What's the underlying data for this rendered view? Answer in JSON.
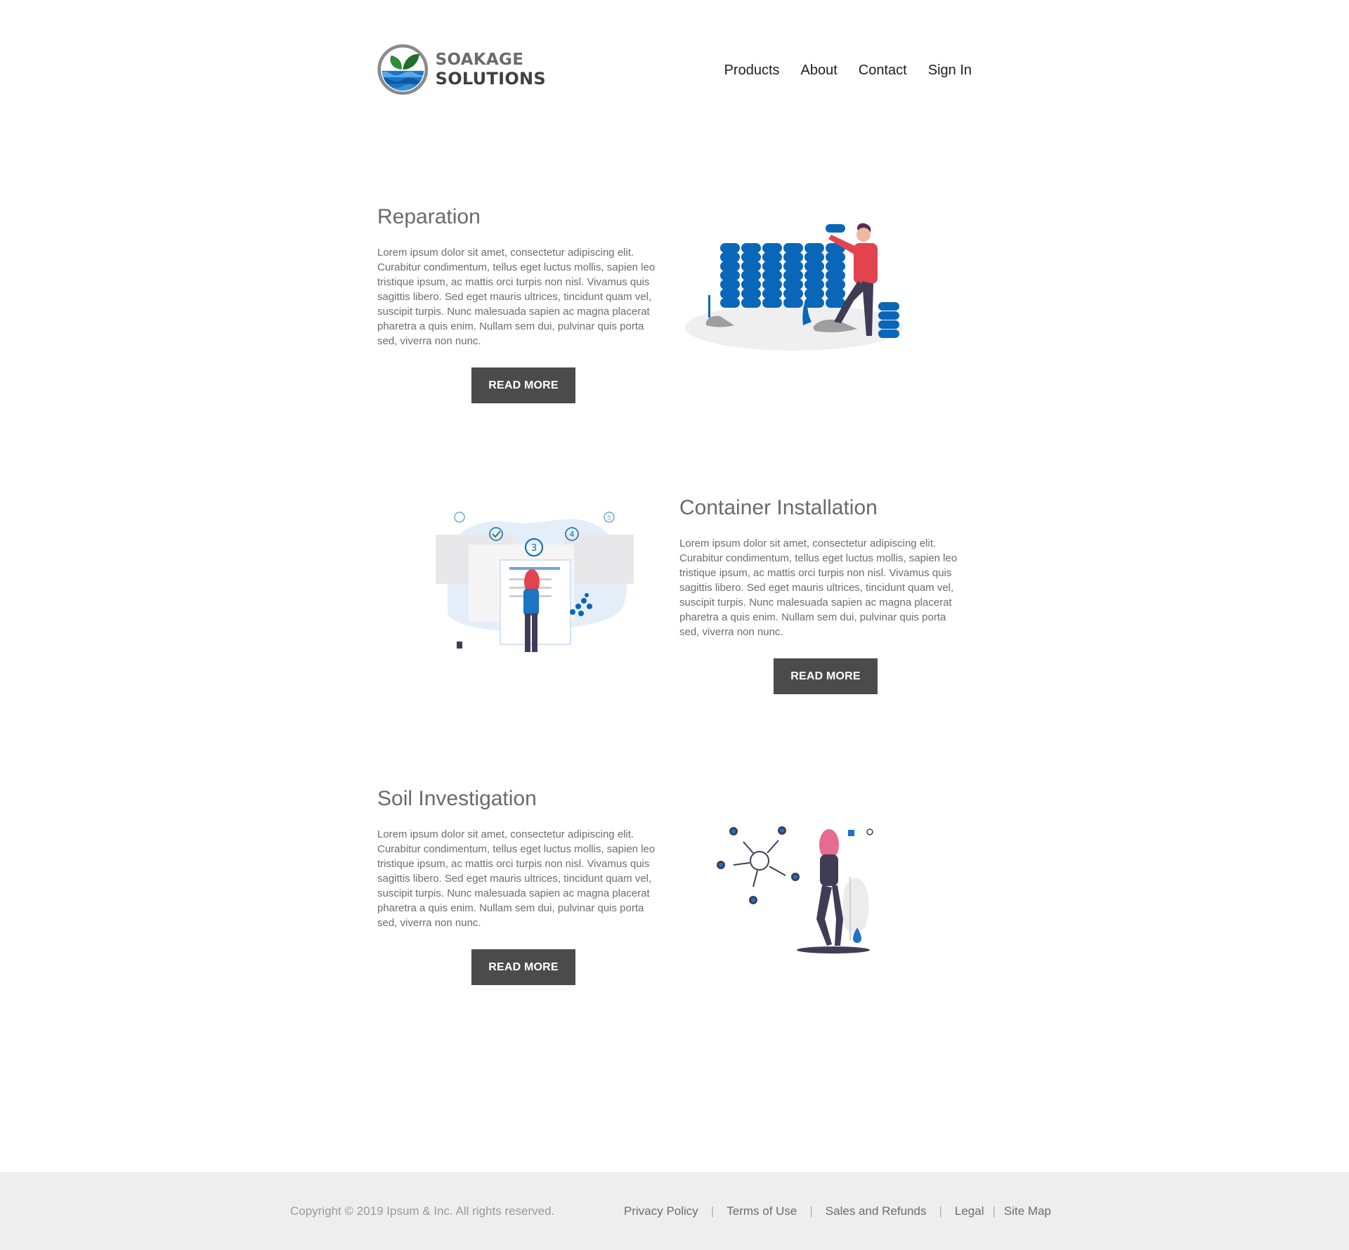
{
  "brand": {
    "line1": "SOAKAGE",
    "line2": "SOLUTIONS"
  },
  "nav": {
    "products": "Products",
    "about": "About",
    "contact": "Contact",
    "sign_in": "Sign In"
  },
  "sections": [
    {
      "title": "Reparation",
      "body": "Lorem ipsum dolor sit amet, consectetur adipiscing elit. Curabitur condimentum, tellus eget luctus mollis, sapien leo tristique ipsum, ac mattis orci turpis non nisl. Vivamus quis sagittis libero. Sed eget mauris ultrices, tincidunt quam vel, suscipit turpis. Nunc malesuada sapien ac magna placerat pharetra a quis enim. Nullam sem dui, pulvinar quis porta sed, viverra non nunc.",
      "button": "READ MORE"
    },
    {
      "title": "Container Installation",
      "body": "Lorem ipsum dolor sit amet, consectetur adipiscing elit. Curabitur condimentum, tellus eget luctus mollis, sapien leo tristique ipsum, ac mattis orci turpis non nisl. Vivamus quis sagittis libero. Sed eget mauris ultrices, tincidunt quam vel, suscipit turpis. Nunc malesuada sapien ac magna placerat pharetra a quis enim. Nullam sem dui, pulvinar quis porta sed, viverra non nunc.",
      "button": "READ MORE",
      "steps": [
        "3",
        "4",
        "5"
      ]
    },
    {
      "title": "Soil Investigation",
      "body": "Lorem ipsum dolor sit amet, consectetur adipiscing elit. Curabitur condimentum, tellus eget luctus mollis, sapien leo tristique ipsum, ac mattis orci turpis non nisl. Vivamus quis sagittis libero. Sed eget mauris ultrices, tincidunt quam vel, suscipit turpis. Nunc malesuada sapien ac magna placerat pharetra a quis enim. Nullam sem dui, pulvinar quis porta sed, viverra non nunc.",
      "button": "READ MORE"
    }
  ],
  "footer": {
    "copyright": "Copyright © 2019 Ipsum & Inc. All rights reserved.",
    "links": [
      "Privacy Policy",
      "Terms of Use",
      "Sales and Refunds",
      "Legal",
      "Site Map"
    ]
  },
  "colors": {
    "accent_blue": "#0a66b8",
    "button": "#4b4b4b",
    "figure_red": "#e2444f",
    "footer_bg": "#eeeeee"
  },
  "icons": [
    "logo-leaf-wave-icon",
    "illustration-worker-crates",
    "illustration-woman-checklist",
    "illustration-woman-network"
  ]
}
